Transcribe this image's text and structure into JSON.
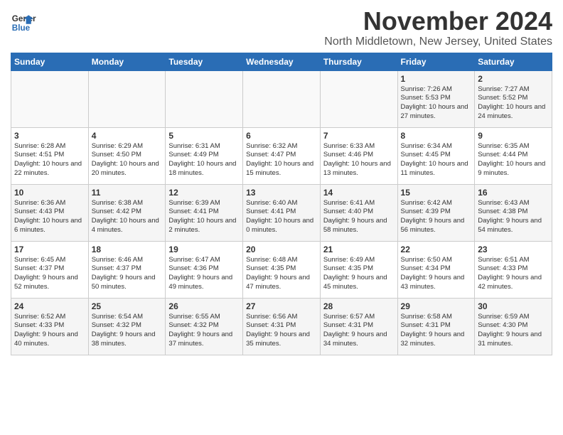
{
  "logo": {
    "general": "General",
    "blue": "Blue"
  },
  "title": "November 2024",
  "location": "North Middletown, New Jersey, United States",
  "weekdays": [
    "Sunday",
    "Monday",
    "Tuesday",
    "Wednesday",
    "Thursday",
    "Friday",
    "Saturday"
  ],
  "weeks": [
    [
      {
        "day": "",
        "info": ""
      },
      {
        "day": "",
        "info": ""
      },
      {
        "day": "",
        "info": ""
      },
      {
        "day": "",
        "info": ""
      },
      {
        "day": "",
        "info": ""
      },
      {
        "day": "1",
        "info": "Sunrise: 7:26 AM\nSunset: 5:53 PM\nDaylight: 10 hours and 27 minutes."
      },
      {
        "day": "2",
        "info": "Sunrise: 7:27 AM\nSunset: 5:52 PM\nDaylight: 10 hours and 24 minutes."
      }
    ],
    [
      {
        "day": "3",
        "info": "Sunrise: 6:28 AM\nSunset: 4:51 PM\nDaylight: 10 hours and 22 minutes."
      },
      {
        "day": "4",
        "info": "Sunrise: 6:29 AM\nSunset: 4:50 PM\nDaylight: 10 hours and 20 minutes."
      },
      {
        "day": "5",
        "info": "Sunrise: 6:31 AM\nSunset: 4:49 PM\nDaylight: 10 hours and 18 minutes."
      },
      {
        "day": "6",
        "info": "Sunrise: 6:32 AM\nSunset: 4:47 PM\nDaylight: 10 hours and 15 minutes."
      },
      {
        "day": "7",
        "info": "Sunrise: 6:33 AM\nSunset: 4:46 PM\nDaylight: 10 hours and 13 minutes."
      },
      {
        "day": "8",
        "info": "Sunrise: 6:34 AM\nSunset: 4:45 PM\nDaylight: 10 hours and 11 minutes."
      },
      {
        "day": "9",
        "info": "Sunrise: 6:35 AM\nSunset: 4:44 PM\nDaylight: 10 hours and 9 minutes."
      }
    ],
    [
      {
        "day": "10",
        "info": "Sunrise: 6:36 AM\nSunset: 4:43 PM\nDaylight: 10 hours and 6 minutes."
      },
      {
        "day": "11",
        "info": "Sunrise: 6:38 AM\nSunset: 4:42 PM\nDaylight: 10 hours and 4 minutes."
      },
      {
        "day": "12",
        "info": "Sunrise: 6:39 AM\nSunset: 4:41 PM\nDaylight: 10 hours and 2 minutes."
      },
      {
        "day": "13",
        "info": "Sunrise: 6:40 AM\nSunset: 4:41 PM\nDaylight: 10 hours and 0 minutes."
      },
      {
        "day": "14",
        "info": "Sunrise: 6:41 AM\nSunset: 4:40 PM\nDaylight: 9 hours and 58 minutes."
      },
      {
        "day": "15",
        "info": "Sunrise: 6:42 AM\nSunset: 4:39 PM\nDaylight: 9 hours and 56 minutes."
      },
      {
        "day": "16",
        "info": "Sunrise: 6:43 AM\nSunset: 4:38 PM\nDaylight: 9 hours and 54 minutes."
      }
    ],
    [
      {
        "day": "17",
        "info": "Sunrise: 6:45 AM\nSunset: 4:37 PM\nDaylight: 9 hours and 52 minutes."
      },
      {
        "day": "18",
        "info": "Sunrise: 6:46 AM\nSunset: 4:37 PM\nDaylight: 9 hours and 50 minutes."
      },
      {
        "day": "19",
        "info": "Sunrise: 6:47 AM\nSunset: 4:36 PM\nDaylight: 9 hours and 49 minutes."
      },
      {
        "day": "20",
        "info": "Sunrise: 6:48 AM\nSunset: 4:35 PM\nDaylight: 9 hours and 47 minutes."
      },
      {
        "day": "21",
        "info": "Sunrise: 6:49 AM\nSunset: 4:35 PM\nDaylight: 9 hours and 45 minutes."
      },
      {
        "day": "22",
        "info": "Sunrise: 6:50 AM\nSunset: 4:34 PM\nDaylight: 9 hours and 43 minutes."
      },
      {
        "day": "23",
        "info": "Sunrise: 6:51 AM\nSunset: 4:33 PM\nDaylight: 9 hours and 42 minutes."
      }
    ],
    [
      {
        "day": "24",
        "info": "Sunrise: 6:52 AM\nSunset: 4:33 PM\nDaylight: 9 hours and 40 minutes."
      },
      {
        "day": "25",
        "info": "Sunrise: 6:54 AM\nSunset: 4:32 PM\nDaylight: 9 hours and 38 minutes."
      },
      {
        "day": "26",
        "info": "Sunrise: 6:55 AM\nSunset: 4:32 PM\nDaylight: 9 hours and 37 minutes."
      },
      {
        "day": "27",
        "info": "Sunrise: 6:56 AM\nSunset: 4:31 PM\nDaylight: 9 hours and 35 minutes."
      },
      {
        "day": "28",
        "info": "Sunrise: 6:57 AM\nSunset: 4:31 PM\nDaylight: 9 hours and 34 minutes."
      },
      {
        "day": "29",
        "info": "Sunrise: 6:58 AM\nSunset: 4:31 PM\nDaylight: 9 hours and 32 minutes."
      },
      {
        "day": "30",
        "info": "Sunrise: 6:59 AM\nSunset: 4:30 PM\nDaylight: 9 hours and 31 minutes."
      }
    ]
  ]
}
